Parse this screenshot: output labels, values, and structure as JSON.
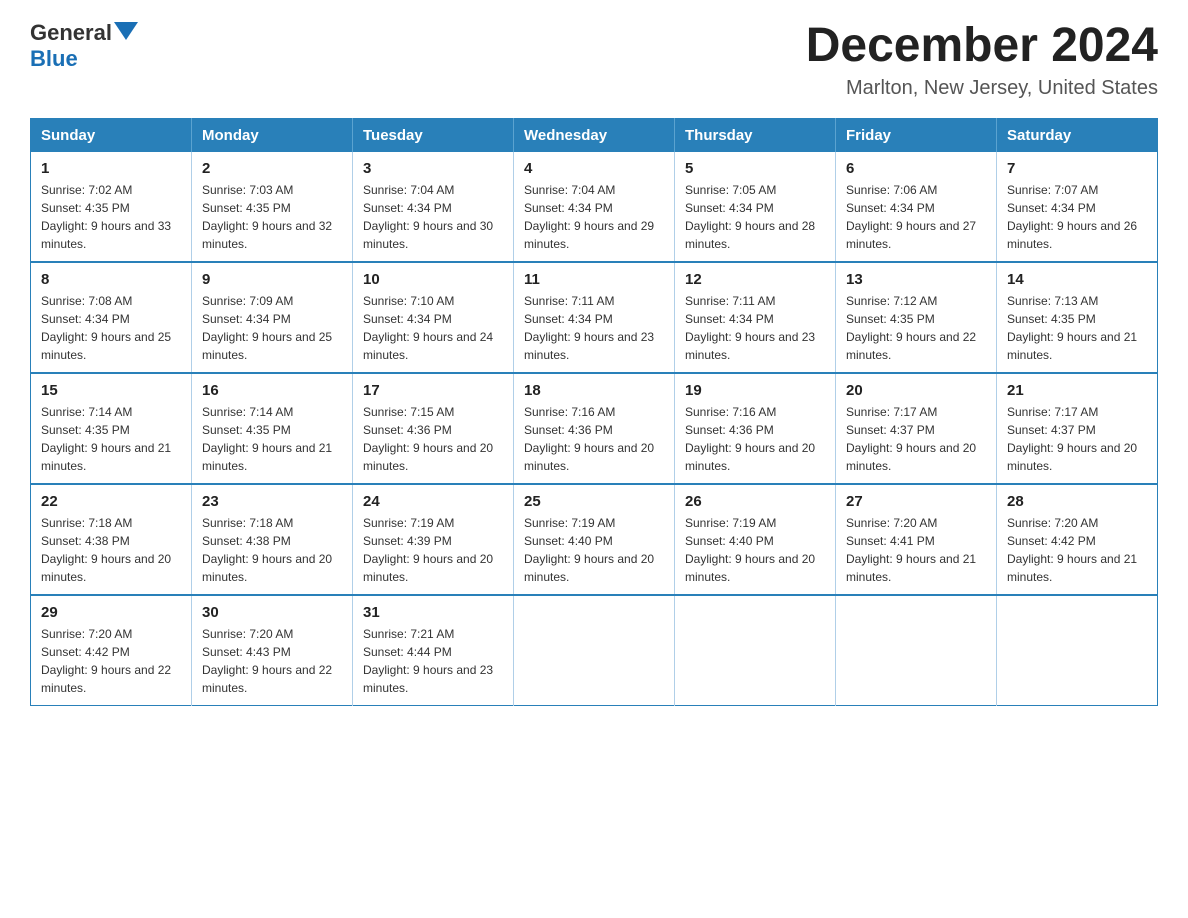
{
  "logo": {
    "text_general": "General",
    "text_blue": "Blue",
    "aria": "GeneralBlue logo"
  },
  "header": {
    "month_title": "December 2024",
    "location": "Marlton, New Jersey, United States"
  },
  "weekdays": [
    "Sunday",
    "Monday",
    "Tuesday",
    "Wednesday",
    "Thursday",
    "Friday",
    "Saturday"
  ],
  "weeks": [
    [
      {
        "day": "1",
        "sunrise": "Sunrise: 7:02 AM",
        "sunset": "Sunset: 4:35 PM",
        "daylight": "Daylight: 9 hours and 33 minutes."
      },
      {
        "day": "2",
        "sunrise": "Sunrise: 7:03 AM",
        "sunset": "Sunset: 4:35 PM",
        "daylight": "Daylight: 9 hours and 32 minutes."
      },
      {
        "day": "3",
        "sunrise": "Sunrise: 7:04 AM",
        "sunset": "Sunset: 4:34 PM",
        "daylight": "Daylight: 9 hours and 30 minutes."
      },
      {
        "day": "4",
        "sunrise": "Sunrise: 7:04 AM",
        "sunset": "Sunset: 4:34 PM",
        "daylight": "Daylight: 9 hours and 29 minutes."
      },
      {
        "day": "5",
        "sunrise": "Sunrise: 7:05 AM",
        "sunset": "Sunset: 4:34 PM",
        "daylight": "Daylight: 9 hours and 28 minutes."
      },
      {
        "day": "6",
        "sunrise": "Sunrise: 7:06 AM",
        "sunset": "Sunset: 4:34 PM",
        "daylight": "Daylight: 9 hours and 27 minutes."
      },
      {
        "day": "7",
        "sunrise": "Sunrise: 7:07 AM",
        "sunset": "Sunset: 4:34 PM",
        "daylight": "Daylight: 9 hours and 26 minutes."
      }
    ],
    [
      {
        "day": "8",
        "sunrise": "Sunrise: 7:08 AM",
        "sunset": "Sunset: 4:34 PM",
        "daylight": "Daylight: 9 hours and 25 minutes."
      },
      {
        "day": "9",
        "sunrise": "Sunrise: 7:09 AM",
        "sunset": "Sunset: 4:34 PM",
        "daylight": "Daylight: 9 hours and 25 minutes."
      },
      {
        "day": "10",
        "sunrise": "Sunrise: 7:10 AM",
        "sunset": "Sunset: 4:34 PM",
        "daylight": "Daylight: 9 hours and 24 minutes."
      },
      {
        "day": "11",
        "sunrise": "Sunrise: 7:11 AM",
        "sunset": "Sunset: 4:34 PM",
        "daylight": "Daylight: 9 hours and 23 minutes."
      },
      {
        "day": "12",
        "sunrise": "Sunrise: 7:11 AM",
        "sunset": "Sunset: 4:34 PM",
        "daylight": "Daylight: 9 hours and 23 minutes."
      },
      {
        "day": "13",
        "sunrise": "Sunrise: 7:12 AM",
        "sunset": "Sunset: 4:35 PM",
        "daylight": "Daylight: 9 hours and 22 minutes."
      },
      {
        "day": "14",
        "sunrise": "Sunrise: 7:13 AM",
        "sunset": "Sunset: 4:35 PM",
        "daylight": "Daylight: 9 hours and 21 minutes."
      }
    ],
    [
      {
        "day": "15",
        "sunrise": "Sunrise: 7:14 AM",
        "sunset": "Sunset: 4:35 PM",
        "daylight": "Daylight: 9 hours and 21 minutes."
      },
      {
        "day": "16",
        "sunrise": "Sunrise: 7:14 AM",
        "sunset": "Sunset: 4:35 PM",
        "daylight": "Daylight: 9 hours and 21 minutes."
      },
      {
        "day": "17",
        "sunrise": "Sunrise: 7:15 AM",
        "sunset": "Sunset: 4:36 PM",
        "daylight": "Daylight: 9 hours and 20 minutes."
      },
      {
        "day": "18",
        "sunrise": "Sunrise: 7:16 AM",
        "sunset": "Sunset: 4:36 PM",
        "daylight": "Daylight: 9 hours and 20 minutes."
      },
      {
        "day": "19",
        "sunrise": "Sunrise: 7:16 AM",
        "sunset": "Sunset: 4:36 PM",
        "daylight": "Daylight: 9 hours and 20 minutes."
      },
      {
        "day": "20",
        "sunrise": "Sunrise: 7:17 AM",
        "sunset": "Sunset: 4:37 PM",
        "daylight": "Daylight: 9 hours and 20 minutes."
      },
      {
        "day": "21",
        "sunrise": "Sunrise: 7:17 AM",
        "sunset": "Sunset: 4:37 PM",
        "daylight": "Daylight: 9 hours and 20 minutes."
      }
    ],
    [
      {
        "day": "22",
        "sunrise": "Sunrise: 7:18 AM",
        "sunset": "Sunset: 4:38 PM",
        "daylight": "Daylight: 9 hours and 20 minutes."
      },
      {
        "day": "23",
        "sunrise": "Sunrise: 7:18 AM",
        "sunset": "Sunset: 4:38 PM",
        "daylight": "Daylight: 9 hours and 20 minutes."
      },
      {
        "day": "24",
        "sunrise": "Sunrise: 7:19 AM",
        "sunset": "Sunset: 4:39 PM",
        "daylight": "Daylight: 9 hours and 20 minutes."
      },
      {
        "day": "25",
        "sunrise": "Sunrise: 7:19 AM",
        "sunset": "Sunset: 4:40 PM",
        "daylight": "Daylight: 9 hours and 20 minutes."
      },
      {
        "day": "26",
        "sunrise": "Sunrise: 7:19 AM",
        "sunset": "Sunset: 4:40 PM",
        "daylight": "Daylight: 9 hours and 20 minutes."
      },
      {
        "day": "27",
        "sunrise": "Sunrise: 7:20 AM",
        "sunset": "Sunset: 4:41 PM",
        "daylight": "Daylight: 9 hours and 21 minutes."
      },
      {
        "day": "28",
        "sunrise": "Sunrise: 7:20 AM",
        "sunset": "Sunset: 4:42 PM",
        "daylight": "Daylight: 9 hours and 21 minutes."
      }
    ],
    [
      {
        "day": "29",
        "sunrise": "Sunrise: 7:20 AM",
        "sunset": "Sunset: 4:42 PM",
        "daylight": "Daylight: 9 hours and 22 minutes."
      },
      {
        "day": "30",
        "sunrise": "Sunrise: 7:20 AM",
        "sunset": "Sunset: 4:43 PM",
        "daylight": "Daylight: 9 hours and 22 minutes."
      },
      {
        "day": "31",
        "sunrise": "Sunrise: 7:21 AM",
        "sunset": "Sunset: 4:44 PM",
        "daylight": "Daylight: 9 hours and 23 minutes."
      },
      null,
      null,
      null,
      null
    ]
  ]
}
